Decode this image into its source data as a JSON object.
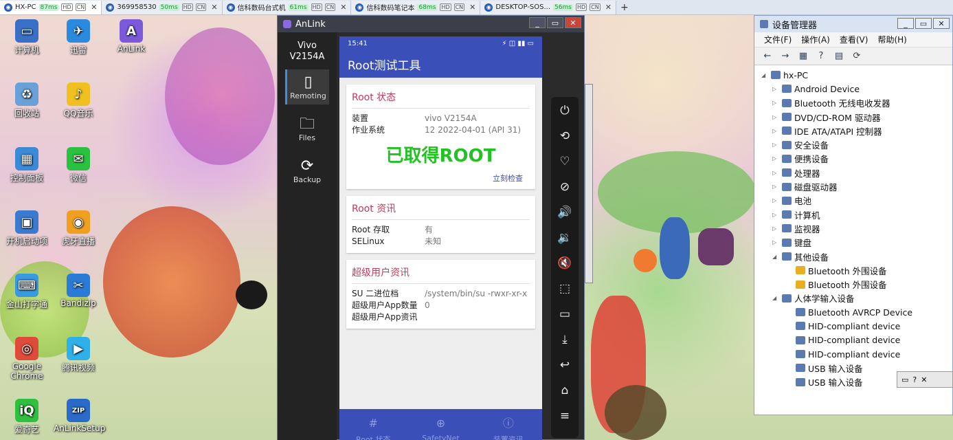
{
  "tabs": [
    {
      "label": "HX-PC",
      "ping": "87ms",
      "active": true
    },
    {
      "label": "369958530",
      "ping": "50ms",
      "active": false
    },
    {
      "label": "信科数码台式机",
      "ping": "61ms",
      "active": false
    },
    {
      "label": "信科数码笔记本",
      "ping": "68ms",
      "active": false
    },
    {
      "label": "DESKTOP-SOS...",
      "ping": "56ms",
      "active": false
    }
  ],
  "tab_tags": [
    "HD",
    "CN"
  ],
  "new_tab": "+",
  "desktop_icons": [
    {
      "label": "计算机",
      "glyph": "▭",
      "color": "#3a6fc8"
    },
    {
      "label": "迅雷",
      "glyph": "✈",
      "color": "#2a8ae0"
    },
    {
      "label": "AnLink",
      "glyph": "A",
      "color": "#7a5ad8"
    },
    {
      "label": "回收站",
      "glyph": "♻",
      "color": "#6aa0d8"
    },
    {
      "label": "QQ音乐",
      "glyph": "♪",
      "color": "#f0c020"
    },
    {
      "label": "控制面板",
      "glyph": "▦",
      "color": "#3a8ad8"
    },
    {
      "label": "微信",
      "glyph": "✉",
      "color": "#2ac040"
    },
    {
      "label": "开机启动项",
      "glyph": "▣",
      "color": "#3a7ad0"
    },
    {
      "label": "虎牙直播",
      "glyph": "◉",
      "color": "#f0a020"
    },
    {
      "label": "金山打字通",
      "glyph": "⌨",
      "color": "#3a9ae0"
    },
    {
      "label": "Bandizip",
      "glyph": "✂",
      "color": "#2a7ad8"
    },
    {
      "label": "Google Chrome",
      "glyph": "◎",
      "color": "#e04a3a"
    },
    {
      "label": "腾讯视频",
      "glyph": "▶",
      "color": "#30b0e8"
    },
    {
      "label": "爱奇艺",
      "glyph": "iQ",
      "color": "#30c040"
    },
    {
      "label": "AnLinkSetup",
      "glyph": "ZIP",
      "color": "#2a6ac8"
    }
  ],
  "anlink": {
    "title": "AnLink",
    "device": "Vivo V2154A",
    "nav": [
      {
        "label": "Remoting",
        "icon": "phone-icon",
        "glyph": "▯"
      },
      {
        "label": "Files",
        "icon": "folder-icon",
        "glyph": "🗀"
      },
      {
        "label": "Backup",
        "icon": "sync-icon",
        "glyph": "⟳"
      }
    ],
    "window_buttons": [
      "_",
      "▭",
      "✕"
    ],
    "phone": {
      "time": "15:41",
      "status_icons": "⚡ ◫ ▮▮ ▭",
      "app_title": "Root测试工具",
      "cards": [
        {
          "title": "Root 状态",
          "rows": [
            {
              "k": "装置",
              "v": "vivo V2154A"
            },
            {
              "k": "作业系统",
              "v": "12 2022-04-01 (API 31)"
            }
          ],
          "highlight": "已取得ROOT",
          "action": "立刻检查"
        },
        {
          "title": "Root 资讯",
          "rows": [
            {
              "k": "Root 存取",
              "v": "有"
            },
            {
              "k": "SELinux",
              "v": "未知"
            }
          ]
        },
        {
          "title": "超级用户资讯",
          "rows": [
            {
              "k": "SU 二进位档",
              "v": "/system/bin/su -rwxr-xr-x"
            },
            {
              "k": "超级用户App数量",
              "v": "0"
            },
            {
              "k": "超级用户App资讯",
              "v": ""
            }
          ]
        }
      ],
      "bottom_nav": [
        {
          "label": "Root 状态",
          "glyph": "#",
          "active": true
        },
        {
          "label": "SafetyNet",
          "glyph": "⊕",
          "active": false
        },
        {
          "label": "装置资讯",
          "glyph": "ⓘ",
          "active": false
        }
      ]
    },
    "controls": [
      "⏻",
      "⟲",
      "♡",
      "⊘",
      "🔊",
      "🔉",
      "🔇",
      "⬚",
      "▭",
      "⤓",
      "↩",
      "⌂",
      "≡"
    ]
  },
  "devmgr": {
    "title": "设备管理器",
    "menu": [
      "文件(F)",
      "操作(A)",
      "查看(V)",
      "帮助(H)"
    ],
    "toolbar": [
      "←",
      "→",
      "▦",
      "?",
      "▤",
      "⟳"
    ],
    "tree": [
      {
        "label": "hx-PC",
        "level": 0,
        "ex": "◢"
      },
      {
        "label": "Android Device",
        "level": 1,
        "ex": "▷"
      },
      {
        "label": "Bluetooth 无线电收发器",
        "level": 1,
        "ex": "▷"
      },
      {
        "label": "DVD/CD-ROM 驱动器",
        "level": 1,
        "ex": "▷"
      },
      {
        "label": "IDE ATA/ATAPI 控制器",
        "level": 1,
        "ex": "▷"
      },
      {
        "label": "安全设备",
        "level": 1,
        "ex": "▷"
      },
      {
        "label": "便携设备",
        "level": 1,
        "ex": "▷"
      },
      {
        "label": "处理器",
        "level": 1,
        "ex": "▷"
      },
      {
        "label": "磁盘驱动器",
        "level": 1,
        "ex": "▷"
      },
      {
        "label": "电池",
        "level": 1,
        "ex": "▷"
      },
      {
        "label": "计算机",
        "level": 1,
        "ex": "▷"
      },
      {
        "label": "监视器",
        "level": 1,
        "ex": "▷"
      },
      {
        "label": "键盘",
        "level": 1,
        "ex": "▷"
      },
      {
        "label": "其他设备",
        "level": 1,
        "ex": "◢"
      },
      {
        "label": "Bluetooth 外围设备",
        "level": 2,
        "ex": "",
        "warn": true
      },
      {
        "label": "Bluetooth 外围设备",
        "level": 2,
        "ex": "",
        "warn": true
      },
      {
        "label": "人体学输入设备",
        "level": 1,
        "ex": "◢"
      },
      {
        "label": "Bluetooth AVRCP Device",
        "level": 2,
        "ex": ""
      },
      {
        "label": "HID-compliant device",
        "level": 2,
        "ex": ""
      },
      {
        "label": "HID-compliant device",
        "level": 2,
        "ex": ""
      },
      {
        "label": "HID-compliant device",
        "level": 2,
        "ex": ""
      },
      {
        "label": "USB 输入设备",
        "level": 2,
        "ex": ""
      },
      {
        "label": "USB 输入设备",
        "level": 2,
        "ex": ""
      }
    ],
    "window_buttons": [
      "_",
      "▭",
      "✕"
    ]
  },
  "tray": [
    "▭",
    "?",
    "✕"
  ]
}
